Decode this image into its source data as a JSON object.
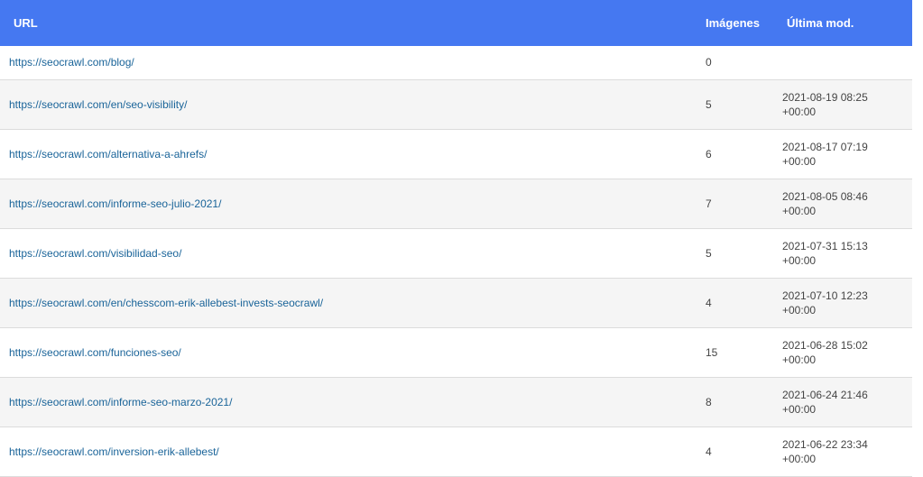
{
  "table": {
    "headers": {
      "url": "URL",
      "images": "Imágenes",
      "lastmod": "Última mod."
    },
    "rows": [
      {
        "url": "https://seocrawl.com/blog/",
        "images": "0",
        "date": "",
        "tz": ""
      },
      {
        "url": "https://seocrawl.com/en/seo-visibility/",
        "images": "5",
        "date": "2021-08-19 08:25",
        "tz": "+00:00"
      },
      {
        "url": "https://seocrawl.com/alternativa-a-ahrefs/",
        "images": "6",
        "date": "2021-08-17 07:19",
        "tz": "+00:00"
      },
      {
        "url": "https://seocrawl.com/informe-seo-julio-2021/",
        "images": "7",
        "date": "2021-08-05 08:46",
        "tz": "+00:00"
      },
      {
        "url": "https://seocrawl.com/visibilidad-seo/",
        "images": "5",
        "date": "2021-07-31 15:13",
        "tz": "+00:00"
      },
      {
        "url": "https://seocrawl.com/en/chesscom-erik-allebest-invests-seocrawl/",
        "images": "4",
        "date": "2021-07-10 12:23",
        "tz": "+00:00"
      },
      {
        "url": "https://seocrawl.com/funciones-seo/",
        "images": "15",
        "date": "2021-06-28 15:02",
        "tz": "+00:00"
      },
      {
        "url": "https://seocrawl.com/informe-seo-marzo-2021/",
        "images": "8",
        "date": "2021-06-24 21:46",
        "tz": "+00:00"
      },
      {
        "url": "https://seocrawl.com/inversion-erik-allebest/",
        "images": "4",
        "date": "2021-06-22 23:34",
        "tz": "+00:00"
      }
    ]
  }
}
